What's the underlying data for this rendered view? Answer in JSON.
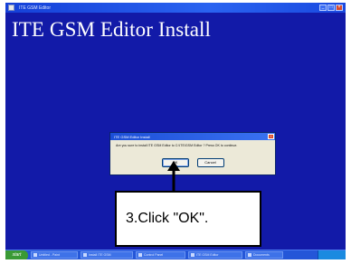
{
  "window": {
    "title": "ITE GSM Editor",
    "headline": "ITE GSM Editor Install"
  },
  "dialog": {
    "title": "ITE GSM Editor Install",
    "message": "Are you sure to install ITE GSM Editor to C:\\ITE\\GSM Editor ? Press OK to continue.",
    "ok_label": "OK",
    "cancel_label": "Cancel"
  },
  "callout": {
    "text": "3.Click \"OK\"."
  },
  "taskbar": {
    "start_label": "start",
    "tasks": [
      "Untitled - Paint",
      "Install ITE GSM",
      "Control Panel",
      "ITE GSM Editor",
      "Documents"
    ],
    "tray_time": ""
  }
}
